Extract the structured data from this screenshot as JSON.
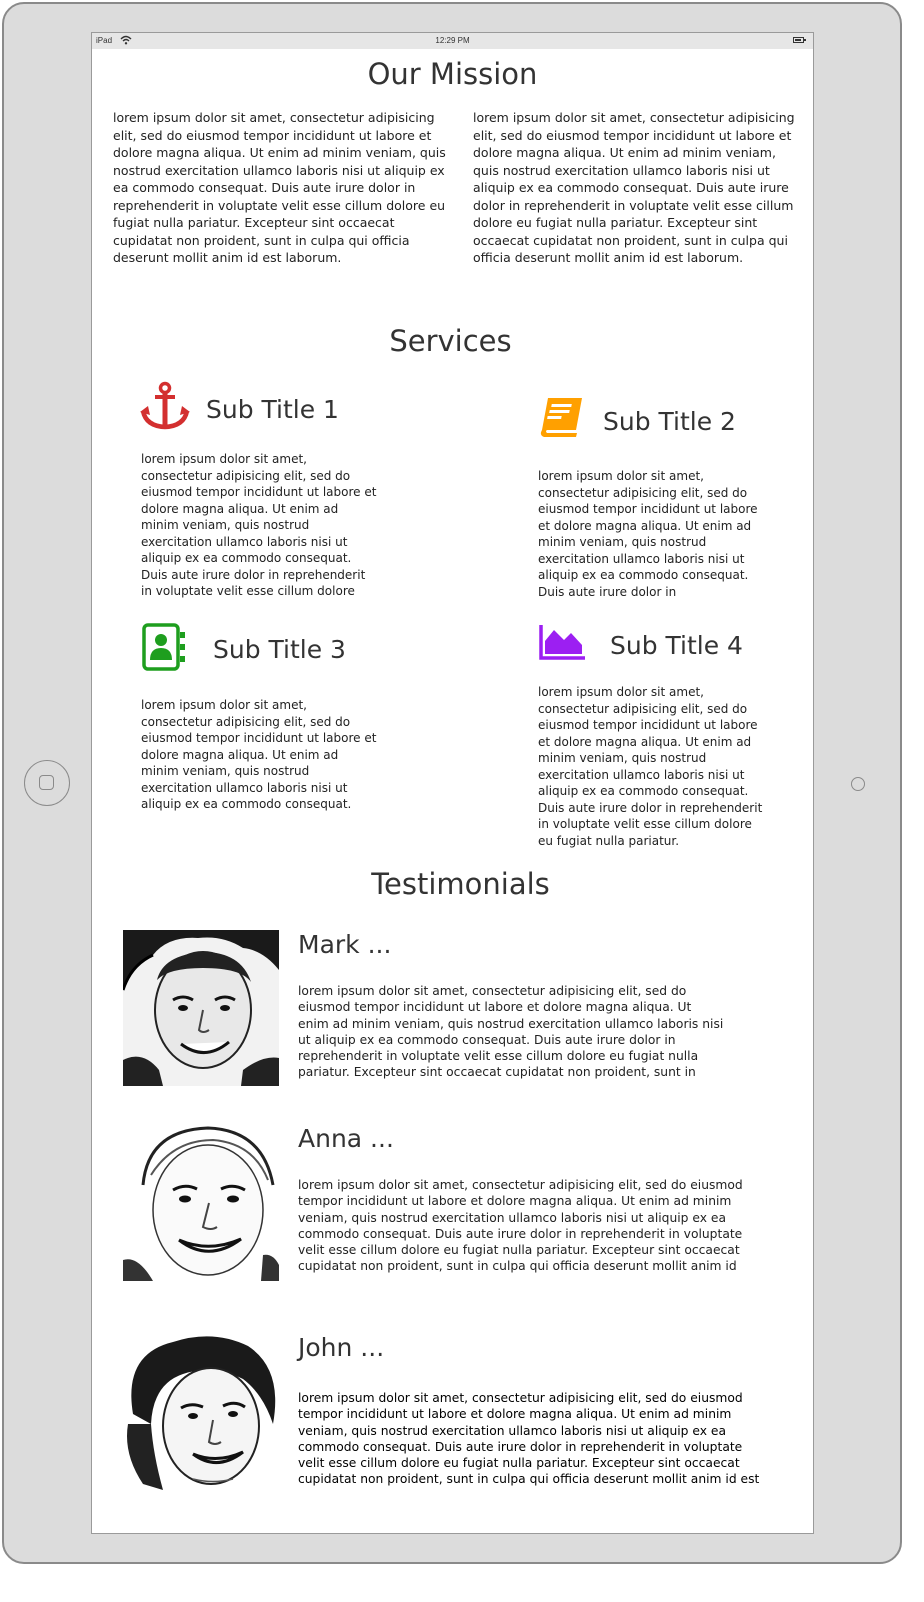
{
  "statusbar": {
    "carrier": "iPad",
    "time": "12:29 PM"
  },
  "mission": {
    "title": "Our Mission",
    "col1": "lorem ipsum dolor sit amet, consectetur adipisicing elit, sed do eiusmod tempor incididunt ut labore et dolore magna aliqua. Ut enim ad minim veniam, quis nostrud exercitation ullamco laboris nisi ut aliquip ex ea commodo consequat. Duis aute irure dolor in reprehenderit in voluptate velit esse cillum dolore eu fugiat nulla pariatur. Excepteur sint occaecat cupidatat non proident, sunt in culpa qui officia deserunt mollit anim id est laborum.",
    "col2": "lorem ipsum dolor sit amet, consectetur adipisicing elit, sed do eiusmod tempor incididunt ut labore et dolore magna aliqua. Ut enim ad minim veniam, quis nostrud exercitation ullamco laboris nisi ut aliquip ex ea commodo consequat. Duis aute irure dolor in reprehenderit in voluptate velit esse cillum dolore eu fugiat nulla pariatur. Excepteur sint occaecat cupidatat non proident, sunt in culpa qui officia deserunt mollit anim id est laborum."
  },
  "services": {
    "title": "Services",
    "items": [
      {
        "title": "Sub Title 1",
        "icon": "anchor-icon",
        "color": "#d32f2f",
        "text": "lorem ipsum dolor sit amet, consectetur adipisicing elit, sed do eiusmod tempor incididunt ut labore et dolore magna aliqua. Ut enim ad minim veniam, quis nostrud exercitation ullamco laboris nisi ut aliquip ex ea commodo consequat. Duis aute irure dolor in reprehenderit in voluptate velit esse cillum dolore"
      },
      {
        "title": "Sub Title 2",
        "icon": "book-icon",
        "color": "#ffa000",
        "text": "lorem ipsum dolor sit amet, consectetur adipisicing elit, sed do eiusmod tempor incididunt ut labore et dolore magna aliqua. Ut enim ad minim veniam, quis nostrud exercitation ullamco laboris nisi ut aliquip ex ea commodo consequat. Duis aute irure dolor in"
      },
      {
        "title": "Sub Title 3",
        "icon": "contact-book-icon",
        "color": "#1e9e1e",
        "text": "lorem ipsum dolor sit amet, consectetur adipisicing elit, sed do eiusmod tempor incididunt ut labore et dolore magna aliqua. Ut enim ad minim veniam, quis nostrud exercitation ullamco laboris nisi ut aliquip ex ea commodo consequat."
      },
      {
        "title": "Sub Title 4",
        "icon": "area-chart-icon",
        "color": "#9c1ff2",
        "text": "lorem ipsum dolor sit amet, consectetur adipisicing elit, sed do eiusmod tempor incididunt ut labore et dolore magna aliqua. Ut enim ad minim veniam, quis nostrud exercitation ullamco laboris nisi ut aliquip ex ea commodo consequat. Duis aute irure dolor in reprehenderit in voluptate velit esse cillum dolore eu fugiat nulla pariatur."
      }
    ]
  },
  "testimonials": {
    "title": "Testimonials",
    "items": [
      {
        "name": "Mark ...",
        "text": "lorem ipsum dolor sit amet, consectetur adipisicing elit, sed do eiusmod tempor incididunt ut labore et dolore magna aliqua. Ut enim ad minim veniam, quis nostrud exercitation ullamco laboris nisi ut aliquip ex ea commodo consequat. Duis aute irure dolor in reprehenderit in voluptate velit esse cillum dolore eu fugiat nulla pariatur. Excepteur sint occaecat cupidatat non proident, sunt in"
      },
      {
        "name": "Anna ...",
        "text": "lorem ipsum dolor sit amet, consectetur adipisicing elit, sed do eiusmod tempor incididunt ut labore et dolore magna aliqua. Ut enim ad minim veniam, quis nostrud exercitation ullamco laboris nisi ut aliquip ex ea commodo consequat. Duis aute irure dolor in reprehenderit in voluptate velit esse cillum dolore eu fugiat nulla pariatur. Excepteur sint occaecat cupidatat non proident, sunt in culpa qui officia deserunt mollit anim id"
      },
      {
        "name": "John ...",
        "text": "lorem ipsum dolor sit amet, consectetur adipisicing elit, sed do eiusmod tempor incididunt ut labore et dolore magna aliqua. Ut enim ad minim veniam, quis nostrud exercitation ullamco laboris nisi ut aliquip ex ea commodo consequat. Duis aute irure dolor in reprehenderit in voluptate velit esse cillum dolore eu fugiat nulla pariatur. Excepteur sint occaecat cupidatat non proident, sunt in culpa qui officia deserunt mollit anim id est"
      }
    ]
  }
}
